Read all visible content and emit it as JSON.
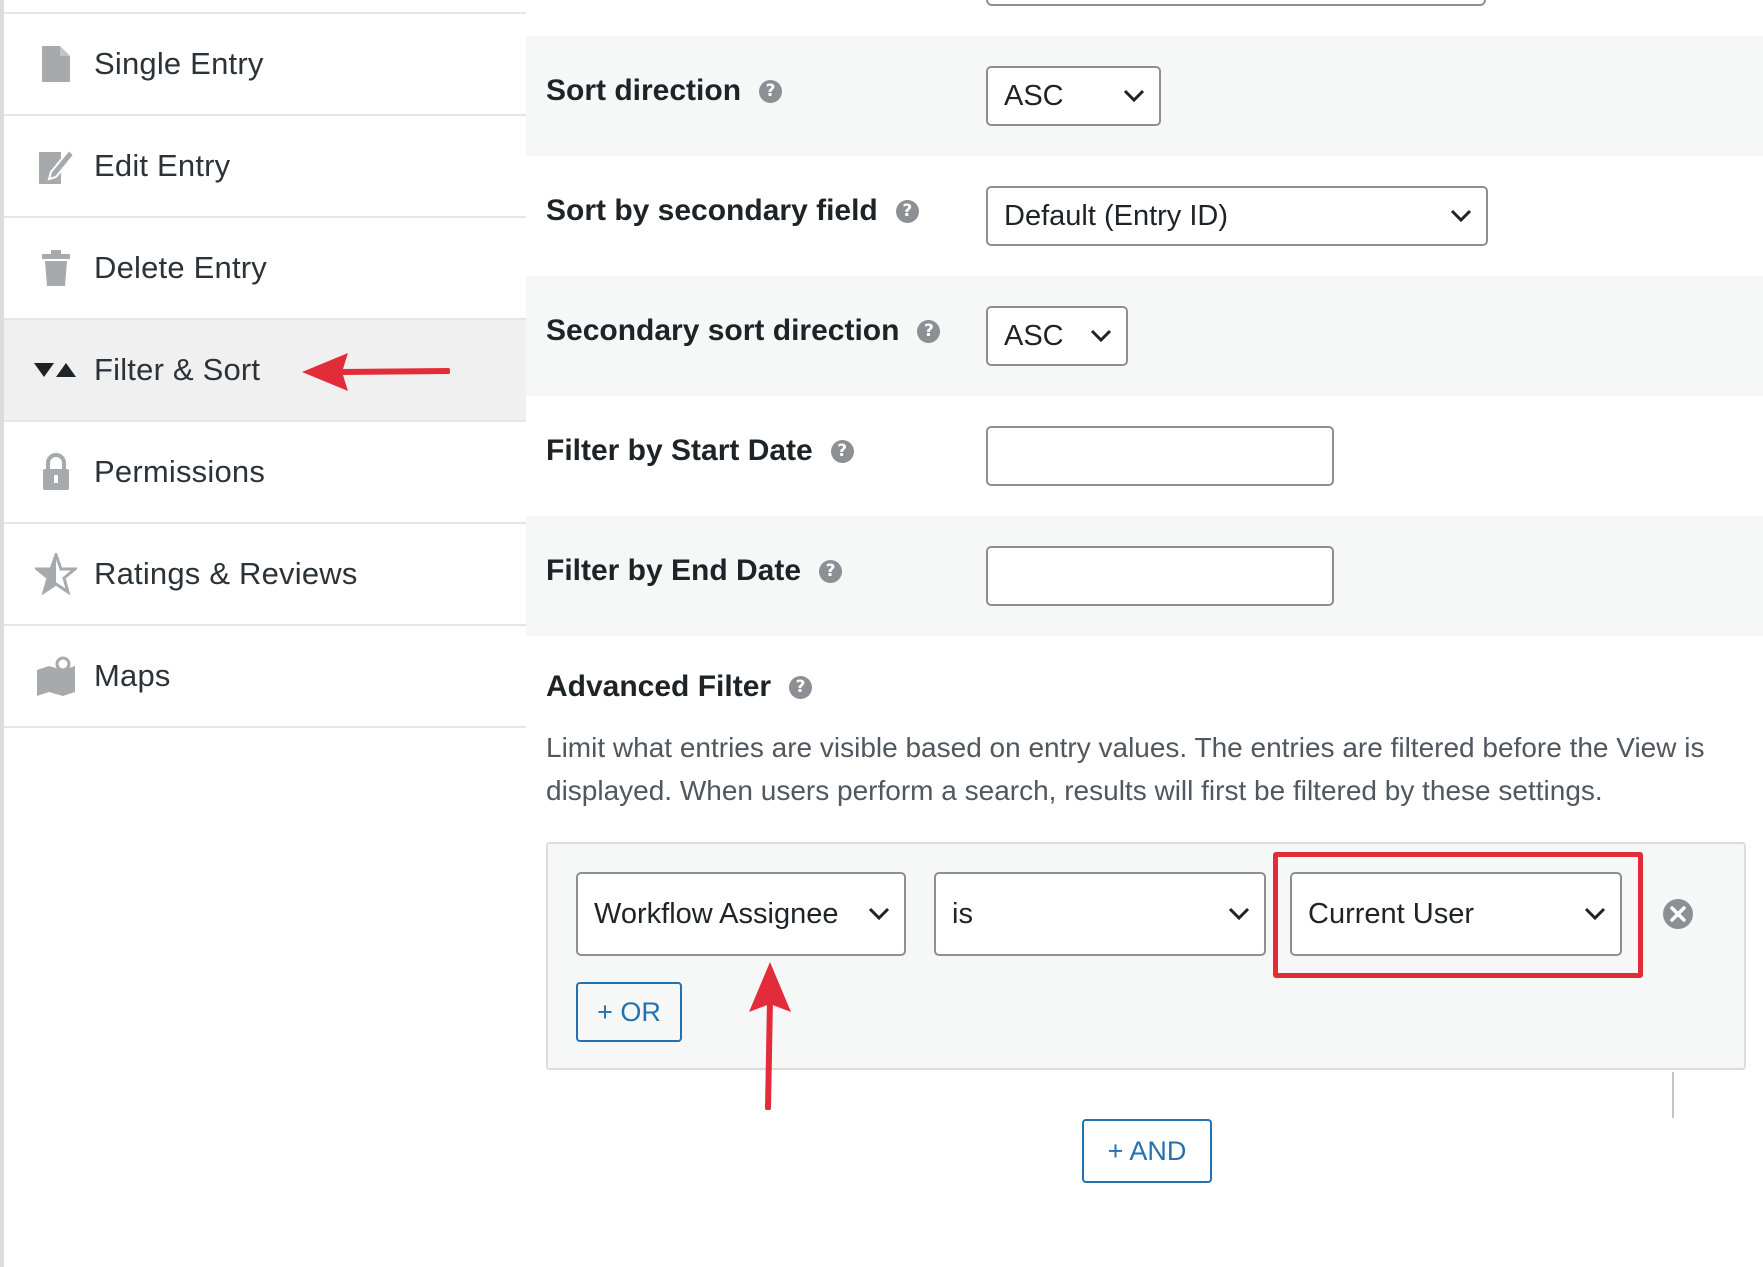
{
  "sidebar": {
    "items": [
      {
        "label": "Single Entry",
        "icon": "document-icon"
      },
      {
        "label": "Edit Entry",
        "icon": "edit-document-icon"
      },
      {
        "label": "Delete Entry",
        "icon": "trash-icon"
      },
      {
        "label": "Filter & Sort",
        "icon": "filter-sort-icon",
        "active": true
      },
      {
        "label": "Permissions",
        "icon": "lock-icon"
      },
      {
        "label": "Ratings & Reviews",
        "icon": "star-icon"
      },
      {
        "label": "Maps",
        "icon": "map-icon"
      }
    ]
  },
  "settings": {
    "sort_direction": {
      "label": "Sort direction",
      "value": "ASC"
    },
    "secondary_field": {
      "label": "Sort by secondary field",
      "value": "Default (Entry ID)"
    },
    "secondary_direction": {
      "label": "Secondary sort direction",
      "value": "ASC"
    },
    "start_date": {
      "label": "Filter by Start Date",
      "value": ""
    },
    "end_date": {
      "label": "Filter by End Date",
      "value": ""
    }
  },
  "advanced_filter": {
    "title": "Advanced Filter",
    "description": "Limit what entries are visible based on entry values. The entries are filtered before the View is displayed. When users perform a search, results will first be filtered by these settings.",
    "field_value": "Workflow Assignee",
    "operator_value": "is",
    "comparison_value": "Current User",
    "or_button": "+ OR",
    "and_button": "+ AND"
  },
  "colors": {
    "accent": "#2271b1",
    "annotation": "#e32c3a",
    "active_bg": "#f0f0f1"
  },
  "help_glyph": "?"
}
